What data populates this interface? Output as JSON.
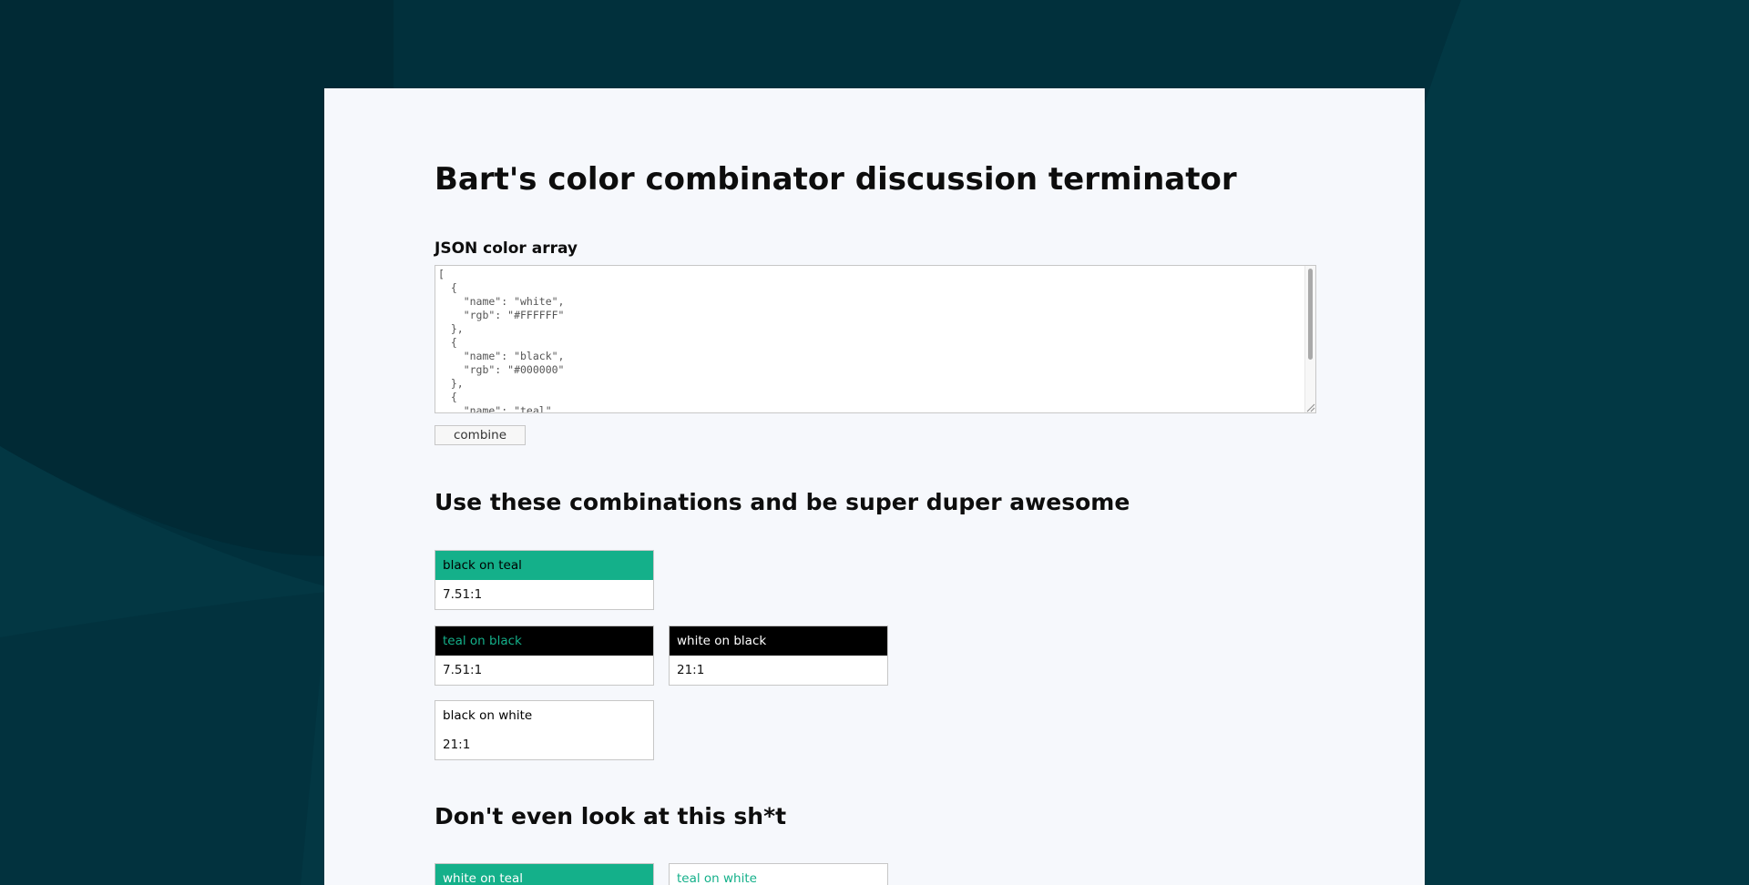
{
  "colors": {
    "teal": "#14b08a",
    "black": "#000000",
    "white": "#FFFFFF",
    "page_background": "#02323f",
    "card_background": "#f6f8fc"
  },
  "page": {
    "title": "Bart's color combinator discussion terminator"
  },
  "input": {
    "label": "JSON color array",
    "value": "[\n  {\n    \"name\": \"white\",\n    \"rgb\": \"#FFFFFF\"\n  },\n  {\n    \"name\": \"black\",\n    \"rgb\": \"#000000\"\n  },\n  {\n    \"name\": \"teal\","
  },
  "combine_button": {
    "label": "combine"
  },
  "good_section": {
    "heading": "Use these combinations and be super duper awesome",
    "combinations": [
      {
        "label": "black on teal",
        "foreground": "#000000",
        "background": "#14b08a",
        "ratio": "7.51:1"
      },
      {
        "label": "teal on black",
        "foreground": "#14b08a",
        "background": "#000000",
        "ratio": "7.51:1"
      },
      {
        "label": "white on black",
        "foreground": "#FFFFFF",
        "background": "#000000",
        "ratio": "21:1"
      },
      {
        "label": "black on white",
        "foreground": "#000000",
        "background": "#FFFFFF",
        "ratio": "21:1"
      }
    ]
  },
  "bad_section": {
    "heading": "Don't even look at this sh*t",
    "combinations": [
      {
        "label": "white on teal",
        "foreground": "#FFFFFF",
        "background": "#14b08a"
      },
      {
        "label": "teal on white",
        "foreground": "#14b08a",
        "background": "#FFFFFF"
      }
    ]
  }
}
